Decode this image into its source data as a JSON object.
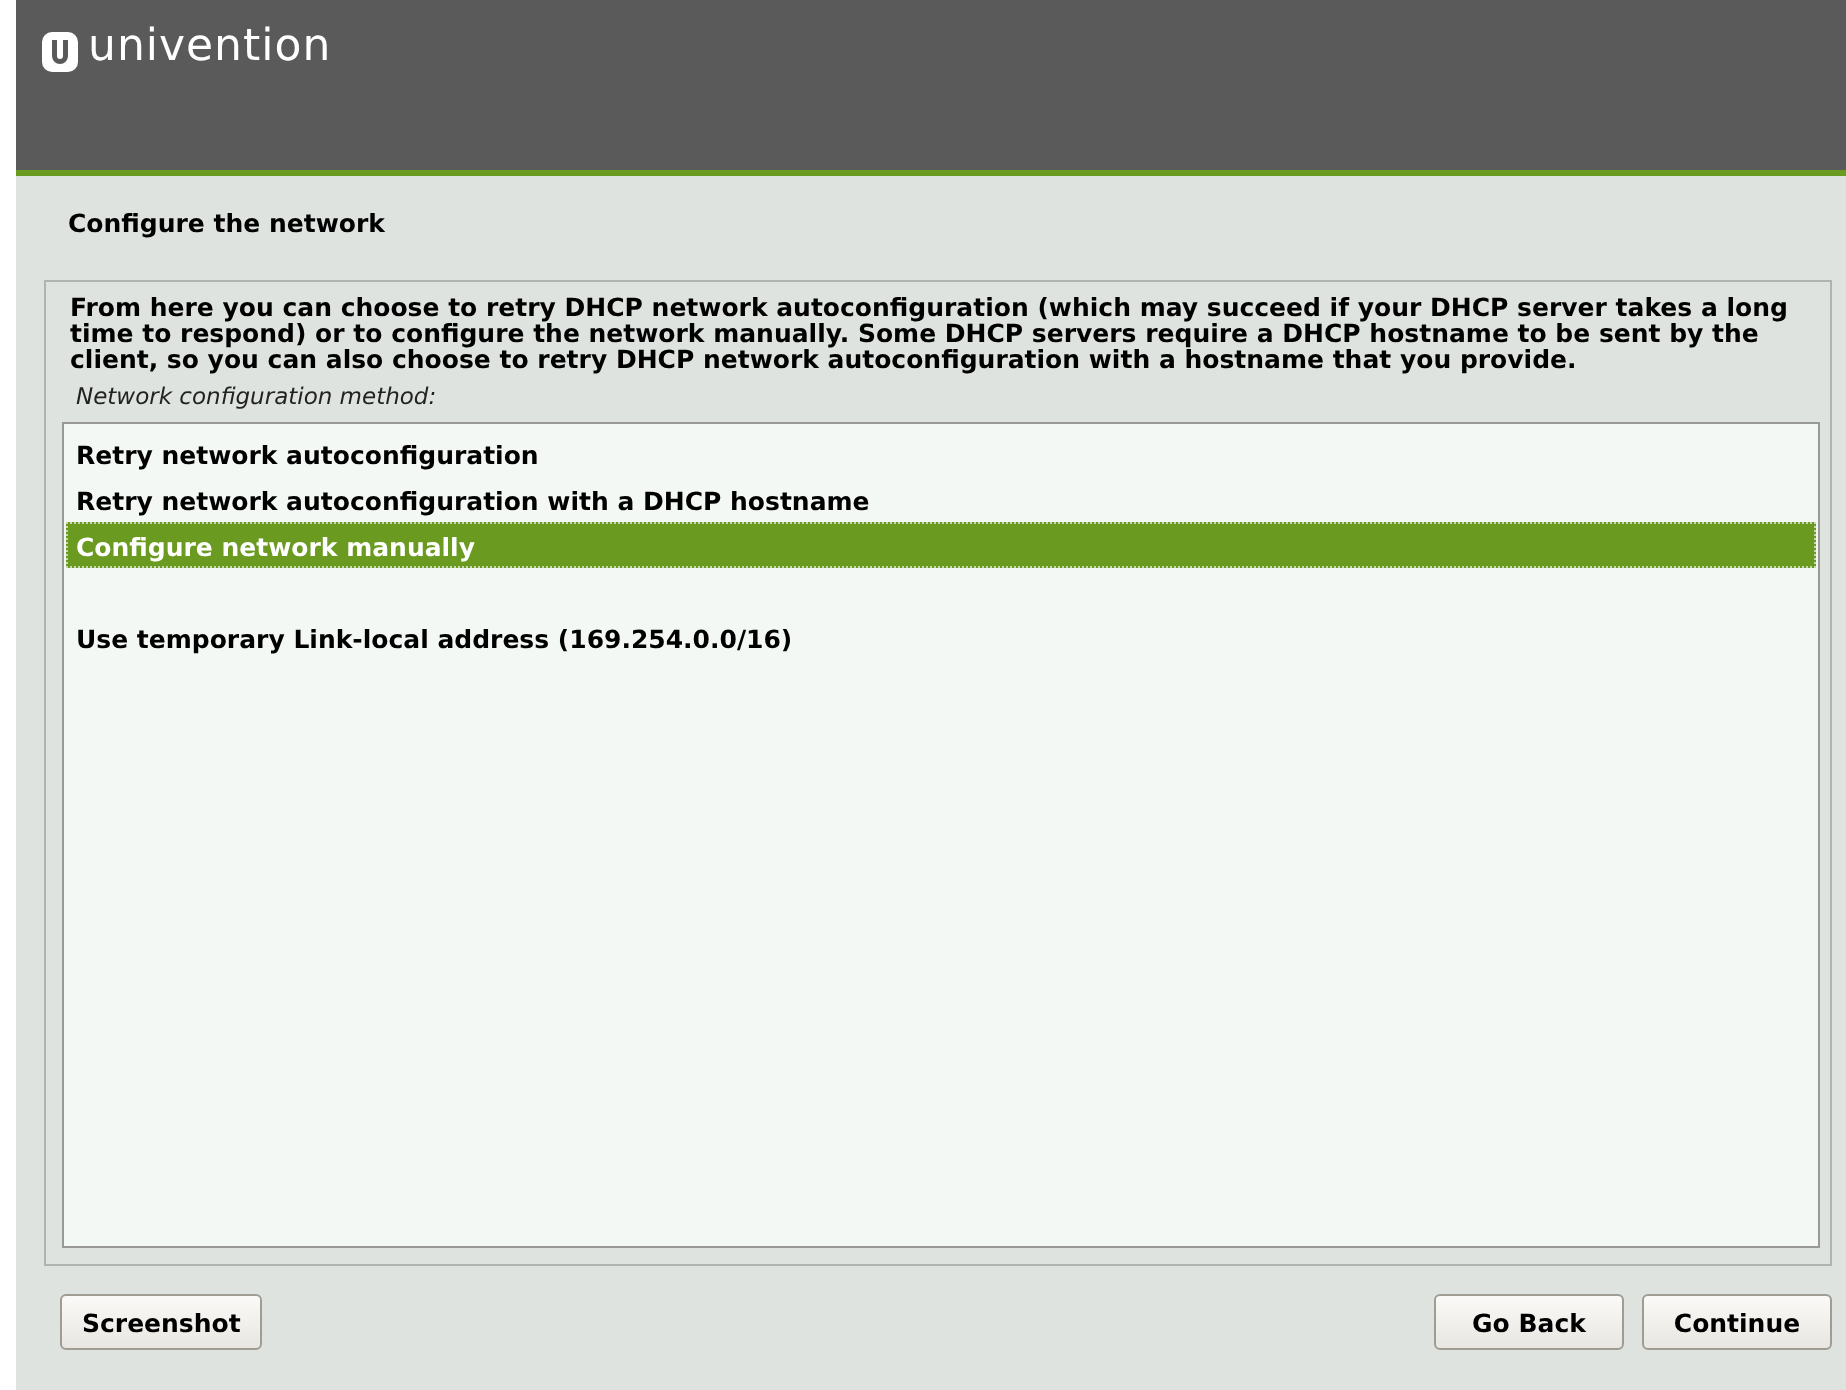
{
  "header": {
    "logo_text": "univention"
  },
  "dialog": {
    "title": "Configure the network",
    "description": "From here you can choose to retry DHCP network autoconfiguration (which may succeed if your DHCP server takes a long time to respond) or to configure the network manually. Some DHCP servers require a DHCP hostname to be sent by the client, so you can also choose to retry DHCP network autoconfiguration with a hostname that you provide.",
    "list_label": "Network configuration method:",
    "options": [
      {
        "label": "Retry network autoconfiguration",
        "selected": false
      },
      {
        "label": "Retry network autoconfiguration with a DHCP hostname",
        "selected": false
      },
      {
        "label": "Configure network manually",
        "selected": true
      },
      {
        "label": "Use temporary Link-local address (169.254.0.0/16)",
        "selected": false
      }
    ]
  },
  "buttons": {
    "left": [
      "Screenshot"
    ],
    "right": [
      "Go Back",
      "Continue"
    ]
  }
}
